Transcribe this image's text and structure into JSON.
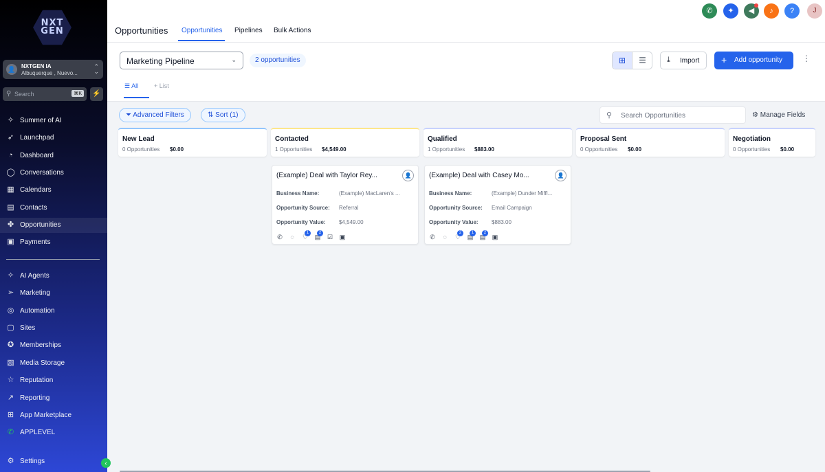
{
  "sidebar": {
    "logo_text": "NXT GEN",
    "account": {
      "avatar": "👤",
      "name": "NXTGEN IA",
      "location": "Albuquerque , Nuevo..."
    },
    "search": {
      "placeholder": "Search",
      "shortcut": "⌘K"
    },
    "items": [
      {
        "label": "Summer of AI",
        "icon": "sparkle-icon"
      },
      {
        "label": "Launchpad",
        "icon": "rocket-icon"
      },
      {
        "label": "Dashboard",
        "icon": "dashboard-icon"
      },
      {
        "label": "Conversations",
        "icon": "chat-icon"
      },
      {
        "label": "Calendars",
        "icon": "calendar-icon"
      },
      {
        "label": "Contacts",
        "icon": "contacts-icon"
      },
      {
        "label": "Opportunities",
        "icon": "opportunities-icon"
      },
      {
        "label": "Payments",
        "icon": "payments-icon"
      },
      {
        "label": "AI Agents",
        "icon": "sparkle-icon"
      },
      {
        "label": "Marketing",
        "icon": "send-icon"
      },
      {
        "label": "Automation",
        "icon": "automation-icon"
      },
      {
        "label": "Sites",
        "icon": "sites-icon"
      },
      {
        "label": "Memberships",
        "icon": "membership-icon"
      },
      {
        "label": "Media Storage",
        "icon": "media-icon"
      },
      {
        "label": "Reputation",
        "icon": "star-icon"
      },
      {
        "label": "Reporting",
        "icon": "chart-line-icon"
      },
      {
        "label": "App Marketplace",
        "icon": "grid-icon"
      },
      {
        "label": "APPLEVEL",
        "icon": "whatsapp-icon"
      },
      {
        "label": "Settings",
        "icon": "gear-icon"
      }
    ]
  },
  "header": {
    "title": "Opportunities",
    "tabs": [
      {
        "label": "Opportunities",
        "active": true
      },
      {
        "label": "Pipelines"
      },
      {
        "label": "Bulk Actions"
      }
    ],
    "user_initial": "J",
    "help_label": "?"
  },
  "toolbar": {
    "pipeline": "Marketing Pipeline",
    "count_badge": "2 opportunities",
    "import_label": "Import",
    "add_label": "Add opportunity",
    "subtabs": [
      {
        "label": "All",
        "active": true
      },
      {
        "label": "List"
      }
    ]
  },
  "filters": {
    "advanced": "Advanced Filters",
    "sort": "Sort (1)",
    "search_placeholder": "Search Opportunities",
    "manage_fields": "Manage Fields"
  },
  "board": {
    "columns": [
      {
        "name": "New Lead",
        "count": "0 Opportunities",
        "amount": "$0.00",
        "accent": "#93c5fd"
      },
      {
        "name": "Contacted",
        "count": "1 Opportunities",
        "amount": "$4,549.00",
        "accent": "#fde68a"
      },
      {
        "name": "Qualified",
        "count": "1 Opportunities",
        "amount": "$883.00",
        "accent": "#c7d2fe"
      },
      {
        "name": "Proposal Sent",
        "count": "0 Opportunities",
        "amount": "$0.00",
        "accent": "#c7d2fe"
      },
      {
        "name": "Negotiation",
        "count": "0 Opportunities",
        "amount": "$0.00",
        "accent": "#c7d2fe"
      }
    ],
    "cards": [
      {
        "title": "(Example) Deal with Taylor Rey...",
        "fields": [
          {
            "label": "Business Name:",
            "value": "(Example) MacLaren's ..."
          },
          {
            "label": "Opportunity Source:",
            "value": "Referral"
          },
          {
            "label": "Opportunity Value:",
            "value": "$4,549.00"
          }
        ],
        "badges": [
          "1",
          "2"
        ]
      },
      {
        "title": "(Example) Deal with Casey Mo...",
        "fields": [
          {
            "label": "Business Name:",
            "value": "(Example) Dunder Miffl..."
          },
          {
            "label": "Opportunity Source:",
            "value": "Email Campaign"
          },
          {
            "label": "Opportunity Value:",
            "value": "$883.00"
          }
        ],
        "badges": [
          "2",
          "1",
          "2"
        ]
      }
    ]
  },
  "colors": {
    "primary": "#2563eb",
    "phone": "#2e8b57",
    "magic": "#2563eb",
    "announce": "#3f7a5c",
    "bell": "#f97316",
    "help": "#3b82f6"
  }
}
